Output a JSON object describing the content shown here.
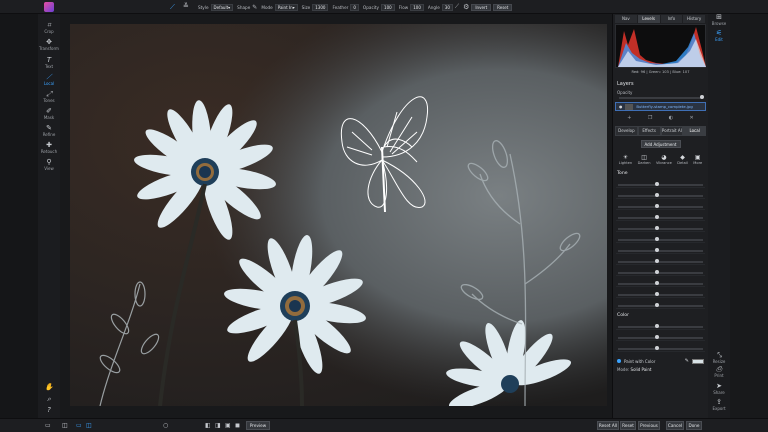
{
  "topbar": {
    "style_label": "Style",
    "style_value": "Default",
    "shape_label": "Shape",
    "mode_label": "Mode",
    "mode_value": "Paint In",
    "size_label": "Size",
    "size_value": "1300",
    "feather_label": "Feather",
    "feather_value": "0",
    "opacity_label": "Opacity",
    "opacity_value": "100",
    "flow_label": "Flow",
    "flow_value": "100",
    "angle_label": "Angle",
    "angle_value": "30",
    "invert_label": "Invert",
    "reset_label": "Reset"
  },
  "tools": [
    {
      "label": "Crop",
      "icon": "crop-icon"
    },
    {
      "label": "Transform",
      "icon": "transform-icon"
    },
    {
      "label": "Text",
      "icon": "text-icon"
    },
    {
      "label": "Local",
      "icon": "brush-icon"
    },
    {
      "label": "Tones",
      "icon": "tones-icon"
    },
    {
      "label": "Mask",
      "icon": "mask-icon"
    },
    {
      "label": "Refine",
      "icon": "refine-icon"
    },
    {
      "label": "Retouch",
      "icon": "retouch-icon"
    },
    {
      "label": "View",
      "icon": "view-icon"
    }
  ],
  "panel": {
    "tabs": [
      "Nav",
      "Levels",
      "Info",
      "History"
    ],
    "rgb_readout": "Red: 96 | Green: 103 | Blue: 107",
    "layers_title": "Layers",
    "opacity_label": "Opacity",
    "layer_name": "Butterfly-stamp_complete.jpg",
    "subtabs": [
      "Develop",
      "Effects",
      "Portrait AI",
      "Local"
    ],
    "add_adjustment_label": "Add Adjustment",
    "modes": [
      {
        "label": "Lighten",
        "icon": "lighten-icon"
      },
      {
        "label": "Darken",
        "icon": "darken-icon"
      },
      {
        "label": "Vibrance",
        "icon": "vibrance-icon"
      },
      {
        "label": "Detail",
        "icon": "detail-icon"
      },
      {
        "label": "More",
        "icon": "more-icon"
      }
    ],
    "tone_title": "Tone",
    "color_title": "Color",
    "paint_with_color_label": "Paint with Color",
    "mode_label": "Mode",
    "mode_value": "Solid Paint"
  },
  "right_rail": [
    {
      "label": "Browse",
      "icon": "browse-icon"
    },
    {
      "label": "Edit",
      "icon": "edit-icon"
    },
    {
      "label": "Resize",
      "icon": "resize-icon"
    },
    {
      "label": "Print",
      "icon": "print-icon"
    },
    {
      "label": "Share",
      "icon": "share-icon"
    },
    {
      "label": "Export",
      "icon": "export-icon"
    }
  ],
  "bottom": {
    "preview_label": "Preview",
    "reset_all_label": "Reset All",
    "reset_label": "Reset",
    "previous_label": "Previous",
    "cancel_label": "Cancel",
    "done_label": "Done"
  },
  "colors": {
    "accent": "#3ba3ff",
    "brand": "#e64fa0"
  }
}
